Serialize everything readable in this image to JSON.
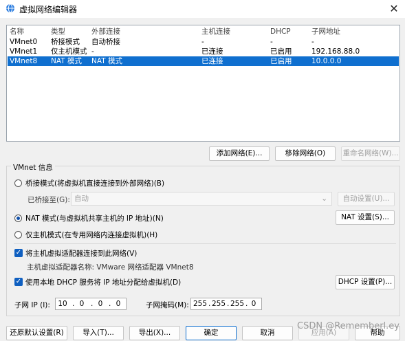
{
  "window": {
    "title": "虚拟网络编辑器",
    "close": "✕"
  },
  "table": {
    "headers": [
      "名称",
      "类型",
      "外部连接",
      "主机连接",
      "DHCP",
      "子网地址"
    ],
    "rows": [
      [
        "VMnet0",
        "桥接模式",
        "自动桥接",
        "-",
        "-",
        "-"
      ],
      [
        "VMnet1",
        "仅主机模式",
        "-",
        "已连接",
        "已启用",
        "192.168.88.0"
      ],
      [
        "VMnet8",
        "NAT 模式",
        "NAT 模式",
        "已连接",
        "已启用",
        "10.0.0.0"
      ]
    ],
    "selected_index": 2
  },
  "list_buttons": {
    "add": "添加网络(E)...",
    "remove": "移除网络(O)",
    "rename": "重命名网络(W)..."
  },
  "vmnet_info": {
    "group_label": "VMnet 信息",
    "bridge_radio": "桥接模式(将虚拟机直接连接到外部网络)(B)",
    "bridged_to_label": "已桥接至(G):",
    "bridged_to_value": "自动",
    "auto_settings": "自动设置(U)...",
    "nat_radio": "NAT 模式(与虚拟机共享主机的 IP 地址)(N)",
    "nat_settings": "NAT 设置(S)...",
    "hostonly_radio": "仅主机模式(在专用网络内连接虚拟机)(H)",
    "connect_adapter_check": "将主机虚拟适配器连接到此网络(V)",
    "adapter_name": "主机虚拟适配器名称: VMware 网络适配器 VMnet8",
    "dhcp_check": "使用本地 DHCP 服务将 IP 地址分配给虚拟机(D)",
    "dhcp_settings": "DHCP 设置(P)...",
    "subnet_ip_label": "子网 IP (I):",
    "subnet_ip": [
      "10",
      "0",
      "0",
      "0"
    ],
    "subnet_mask_label": "子网掩码(M):",
    "subnet_mask": [
      "255",
      "255",
      "255",
      "0"
    ],
    "selected_mode": "nat"
  },
  "footer": {
    "restore": "还原默认设置(R)",
    "import": "导入(T)...",
    "export": "导出(X)...",
    "ok": "确定",
    "cancel": "取消",
    "apply": "应用(A)",
    "help": "帮助"
  },
  "watermark": "CSDN @Rememberl.ey",
  "colors": {
    "selection": "#0f6fcf",
    "checkbox": "#0f5fc0"
  }
}
